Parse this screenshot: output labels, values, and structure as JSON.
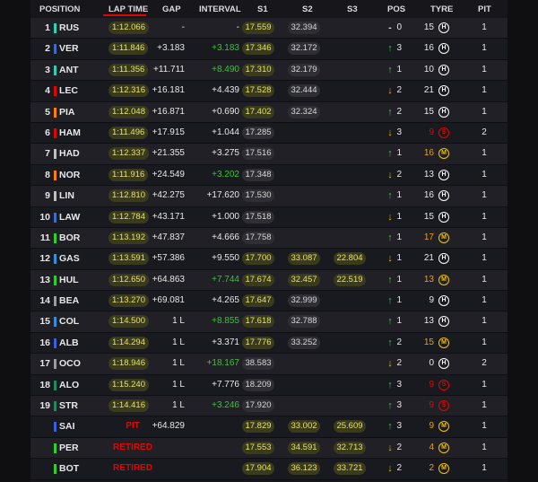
{
  "headers": {
    "position": "POSITION",
    "lap_time": "LAP TIME",
    "gap": "GAP",
    "interval": "INTERVAL",
    "s1": "S1",
    "s2": "S2",
    "s3": "S3",
    "pos": "POS",
    "tyre": "TYRE",
    "pit": "PIT"
  },
  "colors": {
    "accent": "#e10600",
    "sector_yellow": "#e8e070",
    "green": "#3ec23e",
    "orange": "#f0b000"
  },
  "rows": [
    {
      "position": "1",
      "team_color": "#2fd0b8",
      "driver": "RUS",
      "lap_time": "1:12.066",
      "gap": "-",
      "interval": "-",
      "interval_color": "white",
      "s1": "17.559",
      "s1_color": "yellow",
      "s2": "32.394",
      "s2_color": "grey",
      "s3": "",
      "s3_color": "",
      "pos_arrow": "-",
      "pos_dir": "none",
      "pos_change": "0",
      "tyre_laps": "15",
      "tyre_laps_color": "white",
      "tyre": "H",
      "pit": "1"
    },
    {
      "position": "2",
      "team_color": "#3a6cd0",
      "driver": "VER",
      "lap_time": "1:11.846",
      "gap": "+3.183",
      "interval": "+3.183",
      "interval_color": "green",
      "s1": "17.346",
      "s1_color": "yellow",
      "s2": "32.172",
      "s2_color": "grey",
      "s3": "",
      "s3_color": "",
      "pos_arrow": "↑",
      "pos_dir": "up",
      "pos_change": "3",
      "tyre_laps": "16",
      "tyre_laps_color": "white",
      "tyre": "H",
      "pit": "1"
    },
    {
      "position": "3",
      "team_color": "#2fd0b8",
      "driver": "ANT",
      "lap_time": "1:11.356",
      "gap": "+11.711",
      "interval": "+8.490",
      "interval_color": "green",
      "s1": "17.310",
      "s1_color": "yellow",
      "s2": "32.179",
      "s2_color": "grey",
      "s3": "",
      "s3_color": "",
      "pos_arrow": "↑",
      "pos_dir": "up",
      "pos_change": "1",
      "tyre_laps": "10",
      "tyre_laps_color": "white",
      "tyre": "H",
      "pit": "1"
    },
    {
      "position": "4",
      "team_color": "#e10600",
      "driver": "LEC",
      "lap_time": "1:12.316",
      "gap": "+16.181",
      "interval": "+4.439",
      "interval_color": "white",
      "s1": "17.528",
      "s1_color": "yellow",
      "s2": "32.444",
      "s2_color": "grey",
      "s3": "",
      "s3_color": "",
      "pos_arrow": "↓",
      "pos_dir": "down",
      "pos_change": "2",
      "tyre_laps": "21",
      "tyre_laps_color": "white",
      "tyre": "H",
      "pit": "1"
    },
    {
      "position": "5",
      "team_color": "#ff8000",
      "driver": "PIA",
      "lap_time": "1:12.048",
      "gap": "+16.871",
      "interval": "+0.690",
      "interval_color": "white",
      "s1": "17.402",
      "s1_color": "yellow",
      "s2": "32.324",
      "s2_color": "grey",
      "s3": "",
      "s3_color": "",
      "pos_arrow": "↑",
      "pos_dir": "up",
      "pos_change": "2",
      "tyre_laps": "15",
      "tyre_laps_color": "white",
      "tyre": "H",
      "pit": "1"
    },
    {
      "position": "6",
      "team_color": "#e10600",
      "driver": "HAM",
      "lap_time": "1:11.496",
      "gap": "+17.915",
      "interval": "+1.044",
      "interval_color": "white",
      "s1": "17.285",
      "s1_color": "grey",
      "s2": "",
      "s2_color": "",
      "s3": "",
      "s3_color": "",
      "pos_arrow": "↓",
      "pos_dir": "down",
      "pos_change": "3",
      "tyre_laps": "9",
      "tyre_laps_color": "red",
      "tyre": "S",
      "pit": "2"
    },
    {
      "position": "7",
      "team_color": "#c0c0c0",
      "driver": "HAD",
      "lap_time": "1:12.337",
      "gap": "+21.355",
      "interval": "+3.275",
      "interval_color": "white",
      "s1": "17.516",
      "s1_color": "grey",
      "s2": "",
      "s2_color": "",
      "s3": "",
      "s3_color": "",
      "pos_arrow": "↑",
      "pos_dir": "up",
      "pos_change": "1",
      "tyre_laps": "16",
      "tyre_laps_color": "orange",
      "tyre": "M",
      "pit": "1"
    },
    {
      "position": "8",
      "team_color": "#ff8000",
      "driver": "NOR",
      "lap_time": "1:11.916",
      "gap": "+24.549",
      "interval": "+3.202",
      "interval_color": "green",
      "s1": "17.348",
      "s1_color": "grey",
      "s2": "",
      "s2_color": "",
      "s3": "",
      "s3_color": "",
      "pos_arrow": "↓",
      "pos_dir": "down",
      "pos_change": "2",
      "tyre_laps": "13",
      "tyre_laps_color": "white",
      "tyre": "H",
      "pit": "1"
    },
    {
      "position": "9",
      "team_color": "#c0c0c0",
      "driver": "LIN",
      "lap_time": "1:12.810",
      "gap": "+42.275",
      "interval": "+17.620",
      "interval_color": "white",
      "s1": "17.530",
      "s1_color": "grey",
      "s2": "",
      "s2_color": "",
      "s3": "",
      "s3_color": "",
      "pos_arrow": "↑",
      "pos_dir": "up",
      "pos_change": "1",
      "tyre_laps": "16",
      "tyre_laps_color": "white",
      "tyre": "H",
      "pit": "1"
    },
    {
      "position": "10",
      "team_color": "#3a6cd0",
      "driver": "LAW",
      "lap_time": "1:12.784",
      "gap": "+43.171",
      "interval": "+1.000",
      "interval_color": "white",
      "s1": "17.518",
      "s1_color": "grey",
      "s2": "",
      "s2_color": "",
      "s3": "",
      "s3_color": "",
      "pos_arrow": "↓",
      "pos_dir": "down",
      "pos_change": "1",
      "tyre_laps": "15",
      "tyre_laps_color": "white",
      "tyre": "H",
      "pit": "1"
    },
    {
      "position": "11",
      "team_color": "#2ad22a",
      "driver": "BOR",
      "lap_time": "1:13.192",
      "gap": "+47.837",
      "interval": "+4.666",
      "interval_color": "white",
      "s1": "17.758",
      "s1_color": "grey",
      "s2": "",
      "s2_color": "",
      "s3": "",
      "s3_color": "",
      "pos_arrow": "↑",
      "pos_dir": "up",
      "pos_change": "1",
      "tyre_laps": "17",
      "tyre_laps_color": "orange",
      "tyre": "M",
      "pit": "1"
    },
    {
      "position": "12",
      "team_color": "#2f8fe0",
      "driver": "GAS",
      "lap_time": "1:13.591",
      "gap": "+57.386",
      "interval": "+9.550",
      "interval_color": "white",
      "s1": "17.700",
      "s1_color": "yellow",
      "s2": "33.087",
      "s2_color": "yellow",
      "s3": "22.804",
      "s3_color": "yellow",
      "pos_arrow": "↓",
      "pos_dir": "down",
      "pos_change": "1",
      "tyre_laps": "21",
      "tyre_laps_color": "white",
      "tyre": "H",
      "pit": "1"
    },
    {
      "position": "13",
      "team_color": "#2ad22a",
      "driver": "HUL",
      "lap_time": "1:12.650",
      "gap": "+64.863",
      "interval": "+7.744",
      "interval_color": "green",
      "s1": "17.674",
      "s1_color": "yellow",
      "s2": "32.457",
      "s2_color": "yellow",
      "s3": "22.519",
      "s3_color": "yellow",
      "pos_arrow": "↑",
      "pos_dir": "up",
      "pos_change": "1",
      "tyre_laps": "13",
      "tyre_laps_color": "orange",
      "tyre": "M",
      "pit": "1"
    },
    {
      "position": "14",
      "team_color": "#9a9aa0",
      "driver": "BEA",
      "lap_time": "1:13.270",
      "gap": "+69.081",
      "interval": "+4.265",
      "interval_color": "white",
      "s1": "17.647",
      "s1_color": "yellow",
      "s2": "32.999",
      "s2_color": "grey",
      "s3": "",
      "s3_color": "",
      "pos_arrow": "↑",
      "pos_dir": "up",
      "pos_change": "1",
      "tyre_laps": "9",
      "tyre_laps_color": "white",
      "tyre": "H",
      "pit": "1"
    },
    {
      "position": "15",
      "team_color": "#2f8fe0",
      "driver": "COL",
      "lap_time": "1:14.500",
      "gap": "1 L",
      "interval": "+8.855",
      "interval_color": "green",
      "s1": "17.618",
      "s1_color": "yellow",
      "s2": "32.788",
      "s2_color": "grey",
      "s3": "",
      "s3_color": "",
      "pos_arrow": "↑",
      "pos_dir": "up",
      "pos_change": "1",
      "tyre_laps": "13",
      "tyre_laps_color": "white",
      "tyre": "H",
      "pit": "1"
    },
    {
      "position": "16",
      "team_color": "#3a5fe0",
      "driver": "ALB",
      "lap_time": "1:14.294",
      "gap": "1 L",
      "interval": "+3.371",
      "interval_color": "white",
      "s1": "17.776",
      "s1_color": "yellow",
      "s2": "33.252",
      "s2_color": "grey",
      "s3": "",
      "s3_color": "",
      "pos_arrow": "↑",
      "pos_dir": "up",
      "pos_change": "2",
      "tyre_laps": "15",
      "tyre_laps_color": "orange",
      "tyre": "M",
      "pit": "1"
    },
    {
      "position": "17",
      "team_color": "#9a9aa0",
      "driver": "OCO",
      "lap_time": "1:18.946",
      "gap": "1 L",
      "interval": "+18.167",
      "interval_color": "green",
      "s1": "38.583",
      "s1_color": "grey",
      "s2": "",
      "s2_color": "",
      "s3": "",
      "s3_color": "",
      "pos_arrow": "↓",
      "pos_dir": "down",
      "pos_change": "2",
      "tyre_laps": "0",
      "tyre_laps_color": "white",
      "tyre": "H",
      "pit": "2"
    },
    {
      "position": "18",
      "team_color": "#1f8a60",
      "driver": "ALO",
      "lap_time": "1:15.240",
      "gap": "1 L",
      "interval": "+7.776",
      "interval_color": "white",
      "s1": "18.209",
      "s1_color": "grey",
      "s2": "",
      "s2_color": "",
      "s3": "",
      "s3_color": "",
      "pos_arrow": "↑",
      "pos_dir": "up",
      "pos_change": "3",
      "tyre_laps": "9",
      "tyre_laps_color": "red",
      "tyre": "S",
      "pit": "1"
    },
    {
      "position": "19",
      "team_color": "#1f8a60",
      "driver": "STR",
      "lap_time": "1:14.416",
      "gap": "1 L",
      "interval": "+3.246",
      "interval_color": "green",
      "s1": "17.920",
      "s1_color": "grey",
      "s2": "",
      "s2_color": "",
      "s3": "",
      "s3_color": "",
      "pos_arrow": "↑",
      "pos_dir": "up",
      "pos_change": "3",
      "tyre_laps": "9",
      "tyre_laps_color": "red",
      "tyre": "S",
      "pit": "1"
    },
    {
      "position": "",
      "team_color": "#3a5fe0",
      "driver": "SAI",
      "lap_time": "",
      "status": "PIT",
      "gap": "+64.829",
      "interval": "",
      "interval_color": "white",
      "s1": "17.829",
      "s1_color": "yellow",
      "s2": "33.002",
      "s2_color": "yellow",
      "s3": "25.609",
      "s3_color": "yellow",
      "pos_arrow": "↑",
      "pos_dir": "up",
      "pos_change": "3",
      "tyre_laps": "9",
      "tyre_laps_color": "orange",
      "tyre": "M",
      "pit": "1"
    },
    {
      "position": "",
      "team_color": "#2ad22a",
      "driver": "PER",
      "lap_time": "",
      "status": "RETIRED",
      "gap": "",
      "interval": "",
      "interval_color": "white",
      "s1": "17.553",
      "s1_color": "yellow",
      "s2": "34.591",
      "s2_color": "yellow",
      "s3": "32.713",
      "s3_color": "yellow",
      "pos_arrow": "↓",
      "pos_dir": "down",
      "pos_change": "2",
      "tyre_laps": "4",
      "tyre_laps_color": "orange",
      "tyre": "M",
      "pit": "1"
    },
    {
      "position": "",
      "team_color": "#2ad22a",
      "driver": "BOT",
      "lap_time": "",
      "status": "RETIRED",
      "gap": "",
      "interval": "",
      "interval_color": "white",
      "s1": "17.904",
      "s1_color": "yellow",
      "s2": "36.123",
      "s2_color": "yellow",
      "s3": "33.721",
      "s3_color": "yellow",
      "pos_arrow": "↓",
      "pos_dir": "down",
      "pos_change": "2",
      "tyre_laps": "2",
      "tyre_laps_color": "orange",
      "tyre": "M",
      "pit": "1"
    }
  ]
}
